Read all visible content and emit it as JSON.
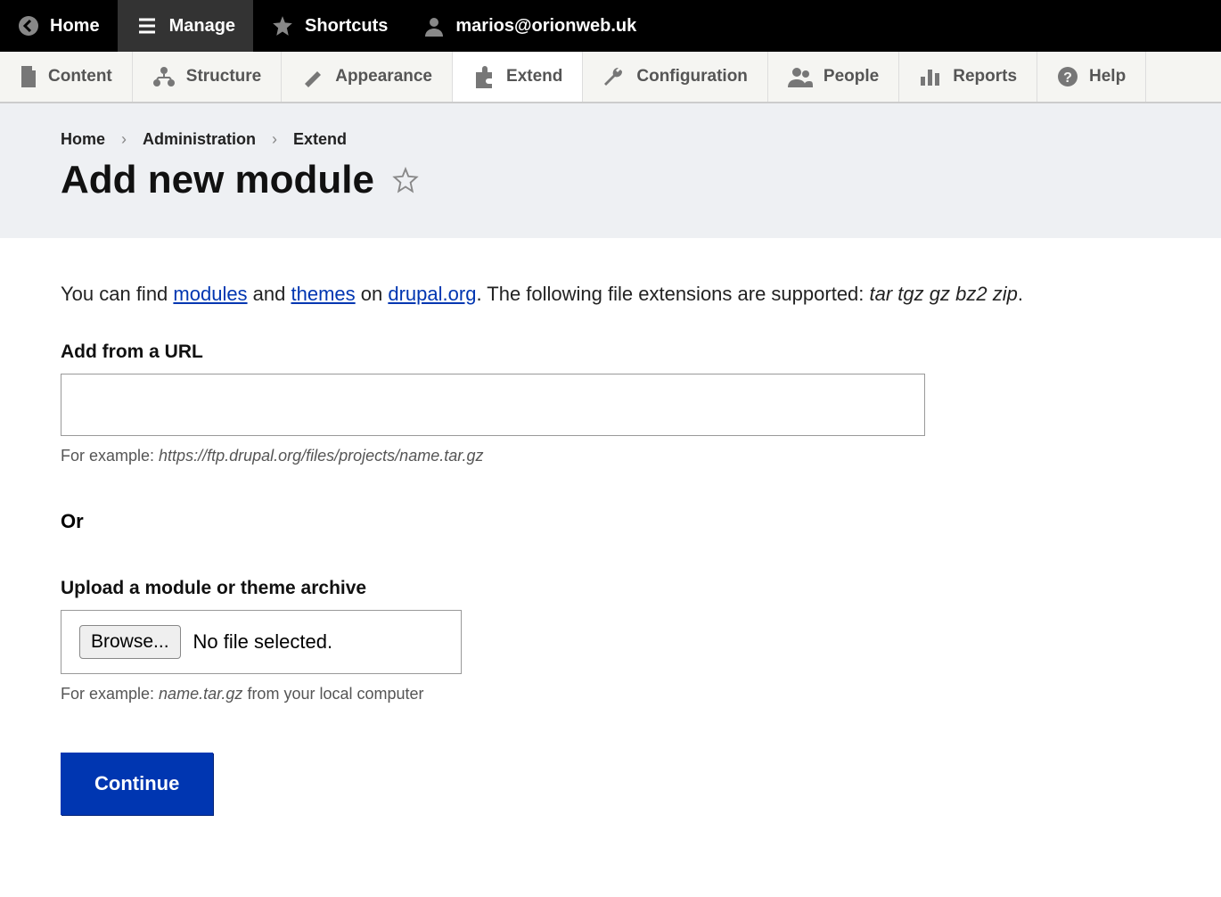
{
  "toolbar": {
    "home": "Home",
    "manage": "Manage",
    "shortcuts": "Shortcuts",
    "user": "marios@orionweb.uk"
  },
  "admin_menu": {
    "content": "Content",
    "structure": "Structure",
    "appearance": "Appearance",
    "extend": "Extend",
    "configuration": "Configuration",
    "people": "People",
    "reports": "Reports",
    "help": "Help"
  },
  "breadcrumb": {
    "home": "Home",
    "administration": "Administration",
    "extend": "Extend"
  },
  "page_title": "Add new module",
  "intro": {
    "p1": "You can find ",
    "link_modules": "modules",
    "p2": " and ",
    "link_themes": "themes",
    "p3": " on ",
    "link_drupal": "drupal.org",
    "p4": ". The following file extensions are supported: ",
    "extensions": "tar tgz gz bz2 zip",
    "p5": "."
  },
  "form": {
    "url_label": "Add from a URL",
    "url_value": "",
    "url_hint_prefix": "For example: ",
    "url_hint_example": "https://ftp.drupal.org/files/projects/name.tar.gz",
    "or": "Or",
    "upload_label": "Upload a module or theme archive",
    "browse": "Browse...",
    "no_file": "No file selected.",
    "upload_hint_prefix": "For example: ",
    "upload_hint_example": "name.tar.gz",
    "upload_hint_suffix": " from your local computer",
    "continue": "Continue"
  }
}
